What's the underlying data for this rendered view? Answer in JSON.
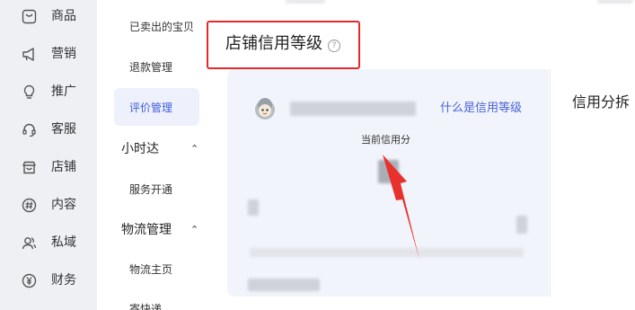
{
  "rail": {
    "items": [
      {
        "label": "商品",
        "icon": "product-icon"
      },
      {
        "label": "营销",
        "icon": "megaphone-icon"
      },
      {
        "label": "推广",
        "icon": "bulb-icon"
      },
      {
        "label": "客服",
        "icon": "headset-icon"
      },
      {
        "label": "店铺",
        "icon": "store-icon"
      },
      {
        "label": "内容",
        "icon": "hashtag-icon"
      },
      {
        "label": "私域",
        "icon": "users-icon"
      },
      {
        "label": "财务",
        "icon": "yen-icon"
      }
    ]
  },
  "submenu": {
    "items": [
      "已卖出的宝贝",
      "退款管理"
    ],
    "active": "评价管理",
    "group1": {
      "title": "小时达",
      "items": [
        "服务开通"
      ]
    },
    "group2": {
      "title": "物流管理",
      "items": [
        "物流主页",
        "寄快递"
      ]
    }
  },
  "main": {
    "title": "店铺信用等级",
    "help_symbol": "?",
    "card": {
      "link": "什么是信用等级",
      "current_score_label": "当前信用分"
    },
    "right_panel_title": "信用分拆"
  },
  "colors": {
    "accent": "#3d5ce0",
    "highlight_box": "#e12b2b",
    "rail_bg": "#eef0f4",
    "card_bg": "#f2f4fb"
  }
}
